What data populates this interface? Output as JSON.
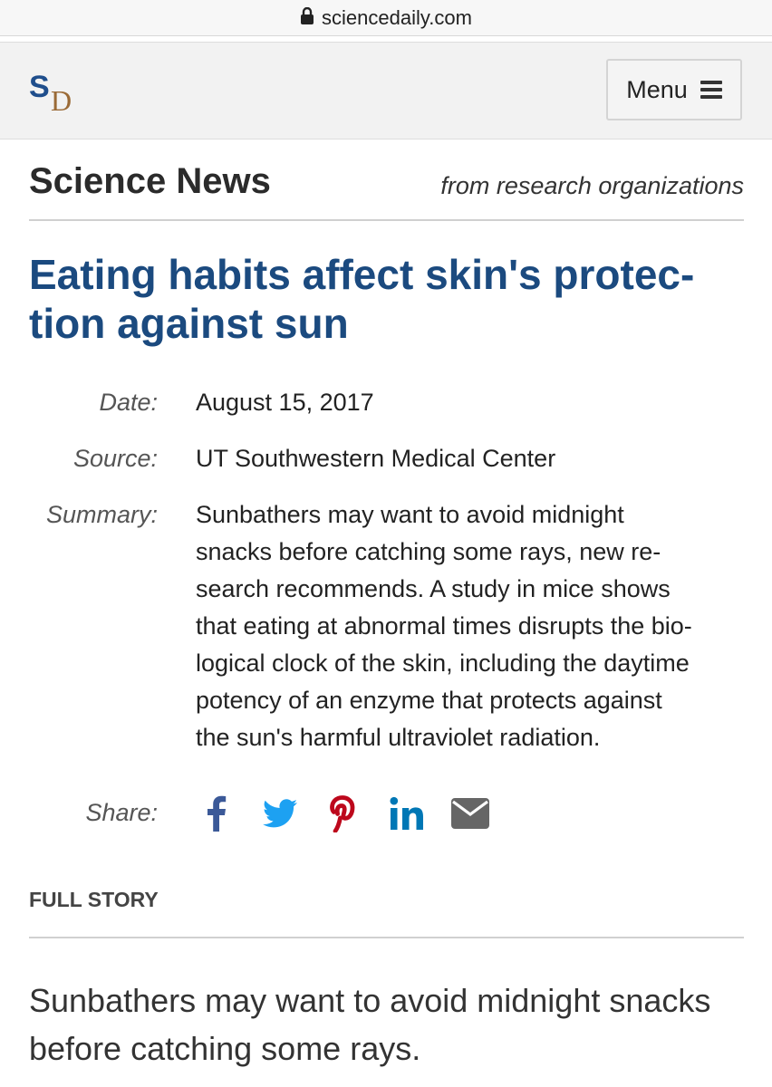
{
  "browser": {
    "url": "sciencedaily.com"
  },
  "site": {
    "logo_s": "S",
    "logo_d": "D",
    "menu_label": "Menu"
  },
  "section": {
    "title": "Science News",
    "subtitle": "from research organizations"
  },
  "article": {
    "headline_line1": "Eating habits affect skin's protec-",
    "headline_line2": "tion against sun",
    "date_label": "Date:",
    "date": "August 15, 2017",
    "source_label": "Source:",
    "source": "UT Southwestern Medical Center",
    "summary_label": "Summary:",
    "summary_lines": [
      "Sunbathers may want to avoid midnight",
      "snacks before catching some rays, new re-",
      "search recommends. A study in mice shows",
      "that eating at abnormal times disrupts the bio-",
      "logical clock of the skin, including the daytime",
      "potency of an enzyme that protects against",
      "the sun's harmful ultraviolet radiation."
    ],
    "share_label": "Share:",
    "share_icons": [
      "facebook-icon",
      "twitter-icon",
      "pinterest-icon",
      "linkedin-icon",
      "email-icon"
    ],
    "full_story_label": "FULL STORY",
    "lede_line1": "Sunbathers may want to avoid midnight snacks",
    "lede_line2": "before catching some rays."
  },
  "colors": {
    "headline": "#1b4a7f",
    "facebook": "#3b5998",
    "twitter": "#1da1f2",
    "pinterest": "#bd081c",
    "linkedin": "#0077b5",
    "email": "#666666"
  }
}
